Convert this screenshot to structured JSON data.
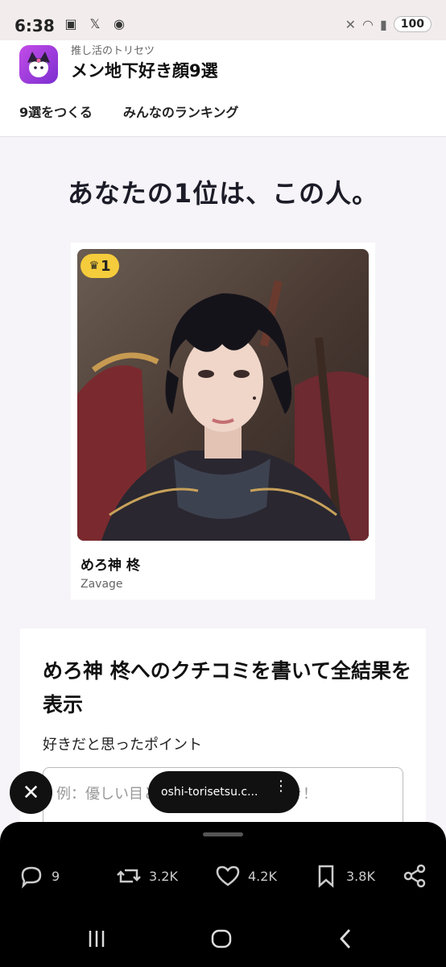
{
  "status": {
    "time": "6:38",
    "battery": "100"
  },
  "app": {
    "subtitle": "推し活のトリセツ",
    "title": "メン地下好き顔9選",
    "nav": [
      "9選をつくる",
      "みんなのランキング"
    ]
  },
  "result": {
    "headline": "あなたの1位は、この人。",
    "rank": "1",
    "name": "めろ神 柊",
    "group": "Zavage"
  },
  "review": {
    "title": "めろ神 柊へのクチコミを書いて全結果を表示",
    "label": "好きだと思ったポイント",
    "placeholder": "例：優しい目と笑った時の表情が好き！"
  },
  "browser": {
    "url": "oshi-torisetsu.c...",
    "close_icon": "close-icon"
  },
  "tweet_actions": {
    "replies": "9",
    "retweets": "3.2K",
    "likes": "4.2K",
    "bookmarks": "3.8K"
  }
}
